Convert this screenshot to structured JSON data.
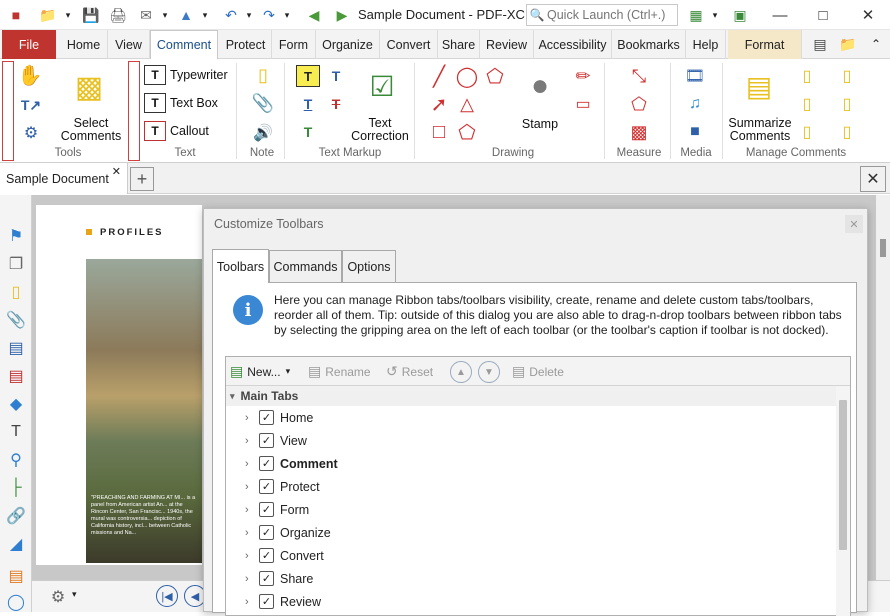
{
  "titlebar": {
    "title": "Sample Document - PDF-XC...",
    "quick_launch_placeholder": "Quick Launch (Ctrl+.)"
  },
  "ribbon": {
    "tabs": [
      "File",
      "Home",
      "View",
      "Comment",
      "Protect",
      "Form",
      "Organize",
      "Convert",
      "Share",
      "Review",
      "Accessibility",
      "Bookmarks",
      "Help",
      "Format"
    ],
    "active_tab": "Comment",
    "groups": {
      "tools": {
        "label": "Tools",
        "select_comments": "Select Comments"
      },
      "text": {
        "label": "Text",
        "typewriter": "Typewriter",
        "text_box": "Text Box",
        "callout": "Callout"
      },
      "note": {
        "label": "Note"
      },
      "text_markup": {
        "label": "Text Markup",
        "text_correction": "Text Correction"
      },
      "drawing": {
        "label": "Drawing",
        "stamp": "Stamp"
      },
      "measure": {
        "label": "Measure"
      },
      "media": {
        "label": "Media"
      },
      "manage_comments": {
        "label": "Manage Comments",
        "summarize": "Summarize Comments"
      }
    }
  },
  "doc_tabs": {
    "current": "Sample Document"
  },
  "page": {
    "heading": "PROFILES",
    "caption": "\"PREACHING AND FARMING AT MI... is a panel from American artist An... at the Rincon Center, San Francisc... 1940s, the mural was controversia... depiction of California history, incl... between Catholic missions and Na..."
  },
  "dialog": {
    "title": "Customize Toolbars",
    "tabs": [
      "Toolbars",
      "Commands",
      "Options"
    ],
    "active_tab": "Toolbars",
    "info": "Here you can manage Ribbon tabs/toolbars visibility, create, rename and delete custom tabs/toolbars, reorder all of them. Tip: outside of this dialog you are also able to drag-n-drop toolbars between ribbon tabs by selecting the gripping area on the left of each toolbar (or the toolbar's caption if toolbar is not docked).",
    "toolbar": {
      "new": "New...",
      "rename": "Rename",
      "reset": "Reset",
      "delete": "Delete"
    },
    "tree_header": "Main Tabs",
    "tree_items": [
      {
        "label": "Home",
        "checked": true,
        "bold": false
      },
      {
        "label": "View",
        "checked": true,
        "bold": false
      },
      {
        "label": "Comment",
        "checked": true,
        "bold": true
      },
      {
        "label": "Protect",
        "checked": true,
        "bold": false
      },
      {
        "label": "Form",
        "checked": true,
        "bold": false
      },
      {
        "label": "Organize",
        "checked": true,
        "bold": false
      },
      {
        "label": "Convert",
        "checked": true,
        "bold": false
      },
      {
        "label": "Share",
        "checked": true,
        "bold": false
      },
      {
        "label": "Review",
        "checked": true,
        "bold": false
      }
    ]
  },
  "colors": {
    "file_tab": "#c0342f",
    "accent": "#1a4f8b",
    "info_icon": "#3a87d4",
    "format_tab": "#f5e8c8"
  }
}
